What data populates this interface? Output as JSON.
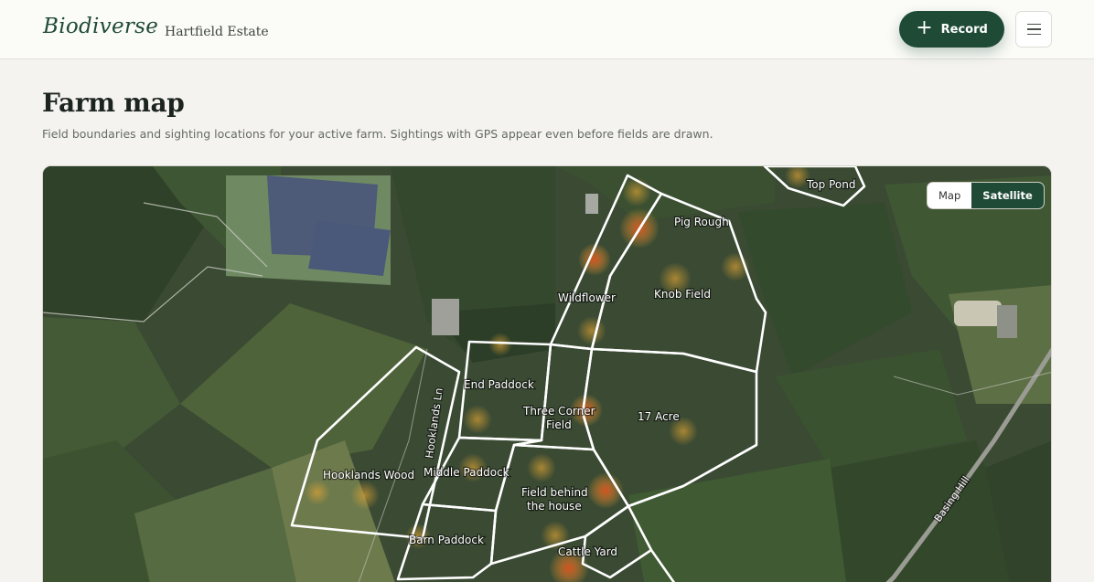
{
  "header": {
    "brand": "Biodiverse",
    "separator": "·",
    "farm_name": "Hartfield Estate",
    "record_label": "Record",
    "record_icon": "plus-icon",
    "menu_icon": "hamburger-menu-icon"
  },
  "page": {
    "title": "Farm map",
    "subtitle": "Field boundaries and sighting locations for your active farm. Sightings with GPS appear even before fields are drawn."
  },
  "map": {
    "view_modes": [
      "Map",
      "Satellite"
    ],
    "active_mode": "Satellite",
    "fields": [
      {
        "id": "top-pond",
        "label": "Top Pond"
      },
      {
        "id": "pig-rough",
        "label": "Pig Rough"
      },
      {
        "id": "wildflower",
        "label": "Wildflower"
      },
      {
        "id": "knob-field",
        "label": "Knob Field"
      },
      {
        "id": "end-paddock",
        "label": "End Paddock"
      },
      {
        "id": "three-corner-field",
        "label": "Three Corner Field"
      },
      {
        "id": "seventeen-acre",
        "label": "17 Acre"
      },
      {
        "id": "hooklands-wood",
        "label": "Hooklands Wood"
      },
      {
        "id": "middle-paddock",
        "label": "Middle Paddock"
      },
      {
        "id": "field-behind-the-house",
        "label": "Field behind the house"
      },
      {
        "id": "barn-paddock",
        "label": "Barn Paddock"
      },
      {
        "id": "cattle-yard",
        "label": "Cattle Yard"
      }
    ],
    "road_labels": {
      "hooklands_ln": "Hooklands Ln",
      "basing_hill": "Basing Hill"
    },
    "colors": {
      "boundary": "#ffffff",
      "heat_low": "#e3a634",
      "heat_high": "#d9541f",
      "accent": "#1e4a36"
    }
  }
}
